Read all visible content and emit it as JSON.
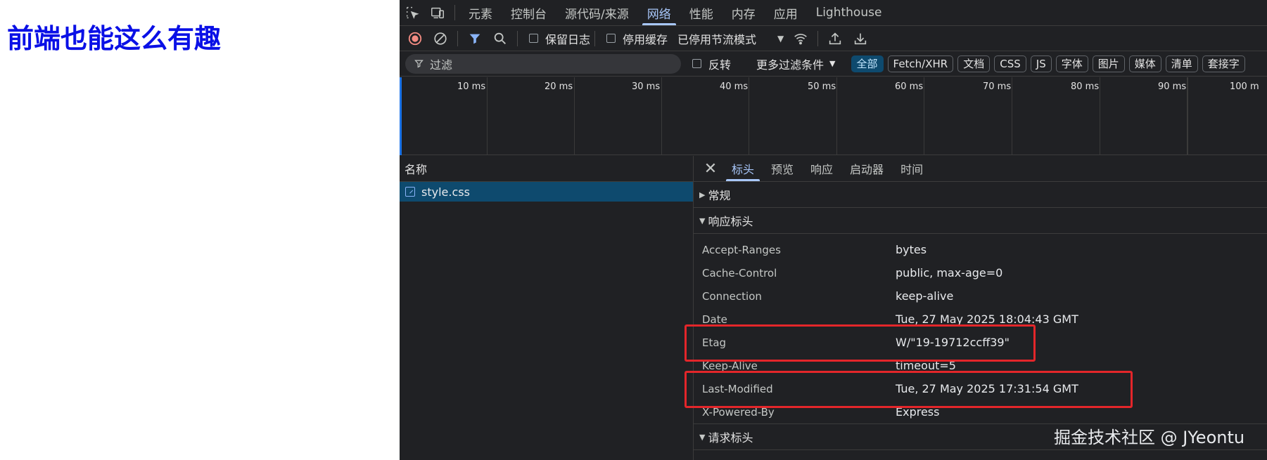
{
  "page": {
    "title": "前端也能这么有趣",
    "title_color": "#0a10e6"
  },
  "devtools": {
    "tabs": [
      {
        "label": "元素"
      },
      {
        "label": "控制台"
      },
      {
        "label": "源代码/来源"
      },
      {
        "label": "网络",
        "active": true
      },
      {
        "label": "性能"
      },
      {
        "label": "内存"
      },
      {
        "label": "应用"
      },
      {
        "label": "Lighthouse"
      }
    ],
    "toolbar": {
      "preserve_log": "保留日志",
      "disable_cache": "停用缓存",
      "throttling": "已停用节流模式"
    },
    "filter": {
      "placeholder": "过滤",
      "invert": "反转",
      "more_filters": "更多过滤条件",
      "types": [
        "全部",
        "Fetch/XHR",
        "文档",
        "CSS",
        "JS",
        "字体",
        "图片",
        "媒体",
        "清单",
        "套接字"
      ]
    },
    "timeline": {
      "ticks": [
        "10 ms",
        "20 ms",
        "30 ms",
        "40 ms",
        "50 ms",
        "60 ms",
        "70 ms",
        "80 ms",
        "90 ms",
        "100 m"
      ]
    },
    "request_list": {
      "column": "名称",
      "items": [
        "style.css"
      ]
    },
    "details": {
      "tabs": [
        "标头",
        "预览",
        "响应",
        "启动器",
        "时间"
      ],
      "sections": {
        "general": "常规",
        "response_headers": "响应标头",
        "request_headers": "请求标头"
      },
      "response_headers": [
        {
          "name": "Accept-Ranges",
          "value": "bytes"
        },
        {
          "name": "Cache-Control",
          "value": "public, max-age=0"
        },
        {
          "name": "Connection",
          "value": "keep-alive"
        },
        {
          "name": "Date",
          "value": "Tue, 27 May 2025 18:04:43 GMT"
        },
        {
          "name": "Etag",
          "value": "W/\"19-19712ccff39\""
        },
        {
          "name": "Keep-Alive",
          "value": "timeout=5"
        },
        {
          "name": "Last-Modified",
          "value": "Tue, 27 May 2025 17:31:54 GMT"
        },
        {
          "name": "X-Powered-By",
          "value": "Express"
        }
      ]
    }
  },
  "watermark": "掘金技术社区 @ JYeontu",
  "colors": {
    "devtools_bg": "#202124",
    "accent": "#a8c7fa",
    "selected_row": "#0e4a6e",
    "highlight_box": "#e3262a"
  }
}
